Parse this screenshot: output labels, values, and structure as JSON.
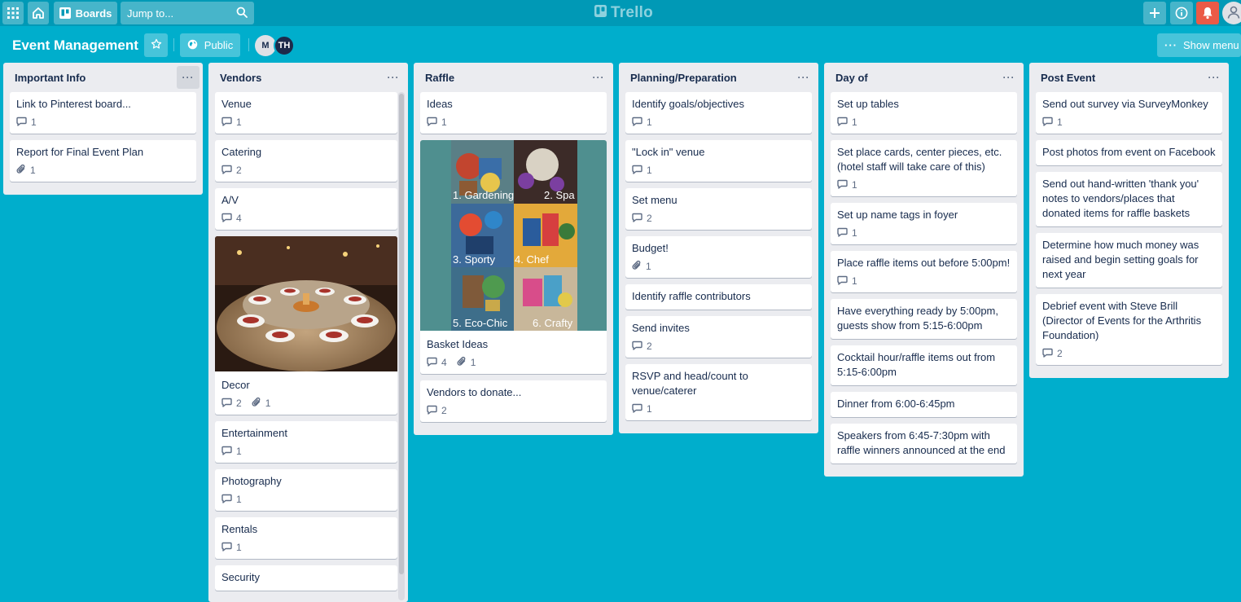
{
  "header": {
    "boards_label": "Boards",
    "search_placeholder": "Jump to...",
    "logo_text": "Trello",
    "icons": [
      "apps-icon",
      "home-icon",
      "boards-icon",
      "search-icon",
      "trello-logo-icon",
      "plus-icon",
      "info-icon",
      "bell-icon",
      "user-icon"
    ],
    "colors": {
      "header_bg": "#0099b6",
      "board_bg": "#00aecc",
      "notification": "#eb5a46"
    }
  },
  "board": {
    "title": "Event Management",
    "visibility": "Public",
    "members": [
      "M",
      "TH"
    ],
    "show_menu_label": "Show menu"
  },
  "lists": {
    "important": {
      "title": "Important Info",
      "cards": [
        {
          "title": "Link to Pinterest board...",
          "comments": "1"
        },
        {
          "title": "Report for Final Event Plan",
          "attachments": "1"
        }
      ]
    },
    "vendors": {
      "title": "Vendors",
      "cards": [
        {
          "title": "Venue",
          "comments": "1"
        },
        {
          "title": "Catering",
          "comments": "2"
        },
        {
          "title": "A/V",
          "comments": "4"
        },
        {
          "title": "Decor",
          "comments": "2",
          "attachments": "1"
        },
        {
          "title": "Entertainment",
          "comments": "1"
        },
        {
          "title": "Photography",
          "comments": "1"
        },
        {
          "title": "Rentals",
          "comments": "1"
        },
        {
          "title": "Security"
        }
      ]
    },
    "raffle": {
      "title": "Raffle",
      "cover_labels": [
        "1. Gardening",
        "2. Spa",
        "3. Sporty",
        "4. Chef",
        "5. Eco-Chic",
        "6. Crafty"
      ],
      "cards": [
        {
          "title": "Ideas",
          "comments": "1"
        },
        {
          "title": "Basket Ideas",
          "comments": "4",
          "attachments": "1"
        },
        {
          "title": "Vendors to donate...",
          "comments": "2"
        }
      ]
    },
    "planning": {
      "title": "Planning/Preparation",
      "cards": [
        {
          "title": "Identify goals/objectives",
          "comments": "1"
        },
        {
          "title": "\"Lock in\" venue",
          "comments": "1"
        },
        {
          "title": "Set menu",
          "comments": "2"
        },
        {
          "title": "Budget!",
          "attachments": "1"
        },
        {
          "title": "Identify raffle contributors"
        },
        {
          "title": "Send invites",
          "comments": "2"
        },
        {
          "title": "RSVP and head/count to venue/caterer",
          "comments": "1"
        }
      ]
    },
    "dayof": {
      "title": "Day of",
      "cards": [
        {
          "title": "Set up tables",
          "comments": "1"
        },
        {
          "title": "Set place cards, center pieces, etc. (hotel staff will take care of this)",
          "comments": "1"
        },
        {
          "title": "Set up name tags in foyer",
          "comments": "1"
        },
        {
          "title": "Place raffle items out before 5:00pm!",
          "comments": "1"
        },
        {
          "title": "Have everything ready by 5:00pm, guests show from 5:15-6:00pm"
        },
        {
          "title": "Cocktail hour/raffle items out from 5:15-6:00pm"
        },
        {
          "title": "Dinner from 6:00-6:45pm"
        },
        {
          "title": "Speakers from 6:45-7:30pm with raffle winners announced at the end"
        }
      ]
    },
    "post": {
      "title": "Post Event",
      "cards": [
        {
          "title": "Send out survey via SurveyMonkey",
          "comments": "1"
        },
        {
          "title": "Post photos from event on Facebook"
        },
        {
          "title": "Send out hand-written 'thank you' notes to vendors/places that donated items for raffle baskets"
        },
        {
          "title": "Determine how much money was raised and begin setting goals for next year"
        },
        {
          "title": "Debrief event with Steve Brill (Director of Events for the Arthritis Foundation)",
          "comments": "2"
        }
      ]
    }
  }
}
